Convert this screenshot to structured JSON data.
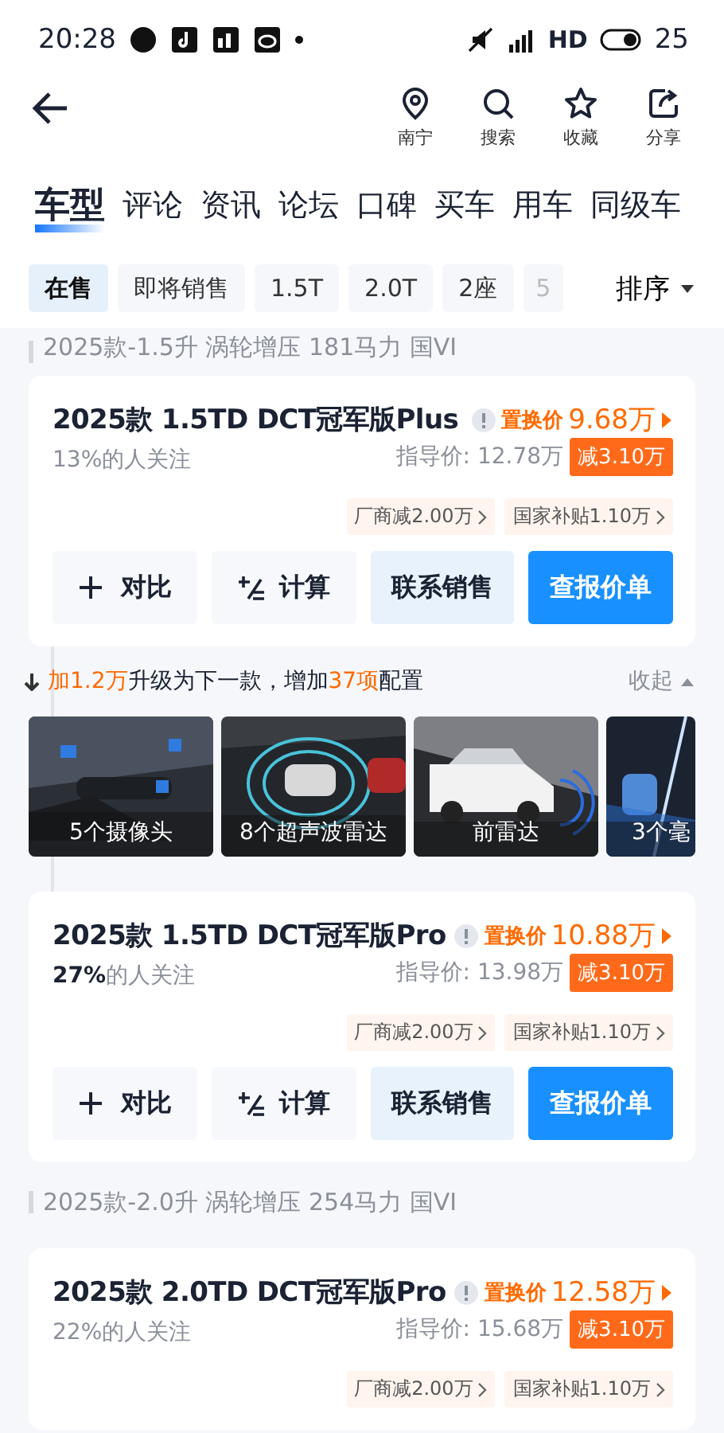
{
  "status_bar": {
    "time": "20:28",
    "network": "HD",
    "battery": "25"
  },
  "header": {
    "actions": [
      {
        "kind": "location",
        "label": "南宁"
      },
      {
        "kind": "search",
        "label": "搜索"
      },
      {
        "kind": "star",
        "label": "收藏"
      },
      {
        "kind": "share",
        "label": "分享"
      }
    ]
  },
  "tabs": [
    {
      "label": "车型",
      "selected": true
    },
    {
      "label": "评论",
      "selected": false
    },
    {
      "label": "资讯",
      "selected": false
    },
    {
      "label": "论坛",
      "selected": false
    },
    {
      "label": "口碑",
      "selected": false
    },
    {
      "label": "买车",
      "selected": false
    },
    {
      "label": "用车",
      "selected": false
    },
    {
      "label": "同级车",
      "selected": false
    }
  ],
  "filters": [
    {
      "label": "在售",
      "selected": true
    },
    {
      "label": "即将销售",
      "selected": false
    },
    {
      "label": "1.5T",
      "selected": false
    },
    {
      "label": "2.0T",
      "selected": false
    },
    {
      "label": "2座",
      "selected": false
    },
    {
      "label": "5",
      "selected": false
    }
  ],
  "sort": {
    "label": "排序"
  },
  "sections": [
    {
      "header": "2025款-1.5升 涡轮增压 181马力 国VI",
      "items": [
        {
          "kind": "card",
          "name": "2025款 1.5TD DCT冠军版Plus",
          "followers": "13%的人关注",
          "trade_in_label": "置换价",
          "trade_in_price": "9.68万",
          "guide_price": "指导价: 12.78万",
          "discount": "减3.10万",
          "offers": [
            "厂商减2.00万",
            "国家补贴1.10万"
          ],
          "buttons": [
            {
              "kind": "compare",
              "label": "对比"
            },
            {
              "kind": "calc",
              "label": "计算"
            },
            {
              "kind": "contact",
              "label": "联系销售"
            },
            {
              "kind": "quote",
              "label": "查报价单"
            }
          ]
        },
        {
          "kind": "upgrade",
          "text": "**加1.2万**升级为下一款，增加**37项**配置",
          "collapse": "收起",
          "features": [
            {
              "caption": "5个摄像头"
            },
            {
              "caption": "8个超声波雷达"
            },
            {
              "caption": "前雷达"
            },
            {
              "caption": "3个毫"
            }
          ]
        },
        {
          "kind": "card",
          "name": "2025款 1.5TD DCT冠军版Pro",
          "followers": "**27%**的人关注",
          "trade_in_label": "置换价",
          "trade_in_price": "10.88万",
          "guide_price": "指导价: 13.98万",
          "discount": "减3.10万",
          "offers": [
            "厂商减2.00万",
            "国家补贴1.10万"
          ],
          "buttons": [
            {
              "kind": "compare",
              "label": "对比"
            },
            {
              "kind": "calc",
              "label": "计算"
            },
            {
              "kind": "contact",
              "label": "联系销售"
            },
            {
              "kind": "quote",
              "label": "查报价单"
            }
          ]
        }
      ]
    },
    {
      "header": "2025款-2.0升 涡轮增压 254马力 国VI",
      "items": [
        {
          "kind": "card",
          "name": "2025款 2.0TD DCT冠军版Pro",
          "followers": "22%的人关注",
          "trade_in_label": "置换价",
          "trade_in_price": "12.58万",
          "guide_price": "指导价: 15.68万",
          "discount": "减3.10万",
          "offers": [
            "厂商减2.00万",
            "国家补贴1.10万"
          ]
        }
      ]
    }
  ]
}
